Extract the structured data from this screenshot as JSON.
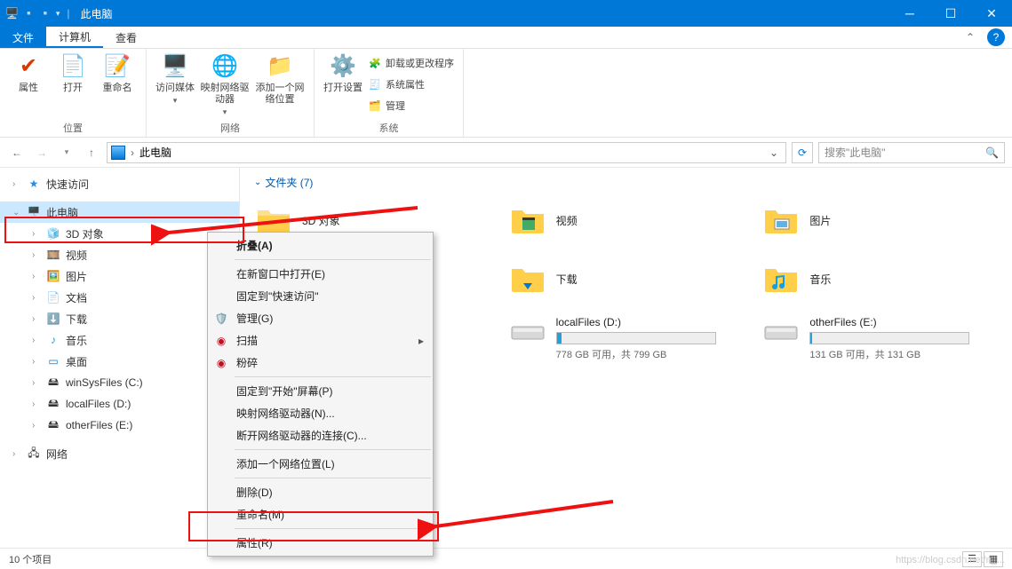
{
  "title": "此电脑",
  "menu": {
    "file": "文件",
    "computer": "计算机",
    "view": "查看"
  },
  "ribbon": {
    "properties": "属性",
    "open": "打开",
    "rename": "重命名",
    "group_location": "位置",
    "access_media": "访问媒体",
    "map_drive": "映射网络驱动器",
    "add_location": "添加一个网络位置",
    "group_network": "网络",
    "open_settings": "打开设置",
    "uninstall": "卸载或更改程序",
    "sys_props": "系统属性",
    "manage": "管理",
    "group_system": "系统"
  },
  "nav": {
    "breadcrumb": "此电脑",
    "search_placeholder": "搜索\"此电脑\""
  },
  "tree": {
    "quick": "快速访问",
    "thispc": "此电脑",
    "3d": "3D 对象",
    "video": "视频",
    "pictures": "图片",
    "docs": "文档",
    "downloads": "下载",
    "music": "音乐",
    "desktop": "桌面",
    "csys": "winSysFiles (C:)",
    "dloc": "localFiles (D:)",
    "eoth": "otherFiles (E:)",
    "network": "网络"
  },
  "content": {
    "folders_header": "文件夹 (7)",
    "f3d": "3D 对象",
    "fvideo": "视频",
    "fpic": "图片",
    "fdown": "下载",
    "fmusic": "音乐"
  },
  "drives": {
    "d_name": "localFiles (D:)",
    "d_free": "778 GB 可用，共 799 GB",
    "e_name": "otherFiles (E:)",
    "e_free": "131 GB 可用，共 131 GB"
  },
  "ctx": {
    "collapse": "折叠(A)",
    "open_new": "在新窗口中打开(E)",
    "pin_quick": "固定到\"快速访问\"",
    "manage": "管理(G)",
    "scan": "扫描",
    "shred": "粉碎",
    "pin_start": "固定到\"开始\"屏幕(P)",
    "map_drive": "映射网络驱动器(N)...",
    "disconnect": "断开网络驱动器的连接(C)...",
    "add_loc": "添加一个网络位置(L)",
    "delete": "删除(D)",
    "rename": "重命名(M)",
    "properties": "属性(R)"
  },
  "status": {
    "items": "10 个项目"
  },
  "watermark": "https://blog.csdn.net/n_..."
}
